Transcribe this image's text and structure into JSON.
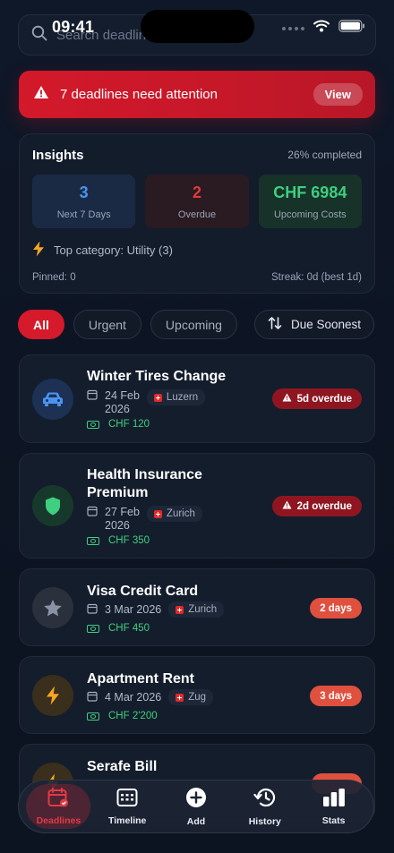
{
  "status_bar": {
    "time": "09:41"
  },
  "search": {
    "placeholder": "Search deadlines"
  },
  "alert": {
    "message": "7 deadlines need attention",
    "action": "View"
  },
  "insights": {
    "title": "Insights",
    "completion": "26% completed",
    "cards": [
      {
        "value": "3",
        "label": "Next 7 Days"
      },
      {
        "value": "2",
        "label": "Overdue"
      },
      {
        "value": "CHF 6984",
        "label": "Upcoming Costs"
      }
    ],
    "top_category": "Top category: Utility (3)",
    "pinned": "Pinned: 0",
    "streak": "Streak: 0d (best 1d)"
  },
  "filters": {
    "chips": [
      "All",
      "Urgent",
      "Upcoming"
    ],
    "active": "All",
    "sort_label": "Due Soonest"
  },
  "deadlines": [
    {
      "title": "Winter Tires Change",
      "date_line1": "24 Feb",
      "date_line2": "2026",
      "location": "Luzern",
      "cost": "CHF 120",
      "badge": "5d overdue",
      "badge_type": "overdue",
      "icon": "car-icon",
      "icon_color": "#4c93f0"
    },
    {
      "title_line1": "Health Insurance",
      "title_line2": "Premium",
      "date_line1": "27 Feb",
      "date_line2": "2026",
      "location": "Zurich",
      "cost": "CHF 350",
      "badge": "2d overdue",
      "badge_type": "overdue",
      "icon": "shield-icon",
      "icon_color": "#3ecf7f"
    },
    {
      "title": "Visa Credit Card",
      "date": "3 Mar 2026",
      "location": "Zurich",
      "cost": "CHF 450",
      "badge": "2 days",
      "badge_type": "days",
      "icon": "star-icon",
      "icon_color": "#8a93a6"
    },
    {
      "title": "Apartment Rent",
      "date": "4 Mar 2026",
      "location": "Zug",
      "cost": "CHF 2'200",
      "badge": "3 days",
      "badge_type": "days",
      "icon": "bolt-icon",
      "icon_color": "#f5a623"
    },
    {
      "title": "Serafe Bill",
      "icon": "bolt-icon"
    }
  ],
  "tabbar": [
    {
      "label": "Deadlines",
      "icon": "calendar-icon",
      "active": true
    },
    {
      "label": "Timeline",
      "icon": "timeline-icon"
    },
    {
      "label": "Add",
      "icon": "plus-icon"
    },
    {
      "label": "History",
      "icon": "history-icon"
    },
    {
      "label": "Stats",
      "icon": "stats-icon"
    }
  ],
  "colors": {
    "accent": "#d51a2b",
    "success": "#3ecf7f",
    "info": "#4c93f0",
    "warning": "#f5a623"
  }
}
